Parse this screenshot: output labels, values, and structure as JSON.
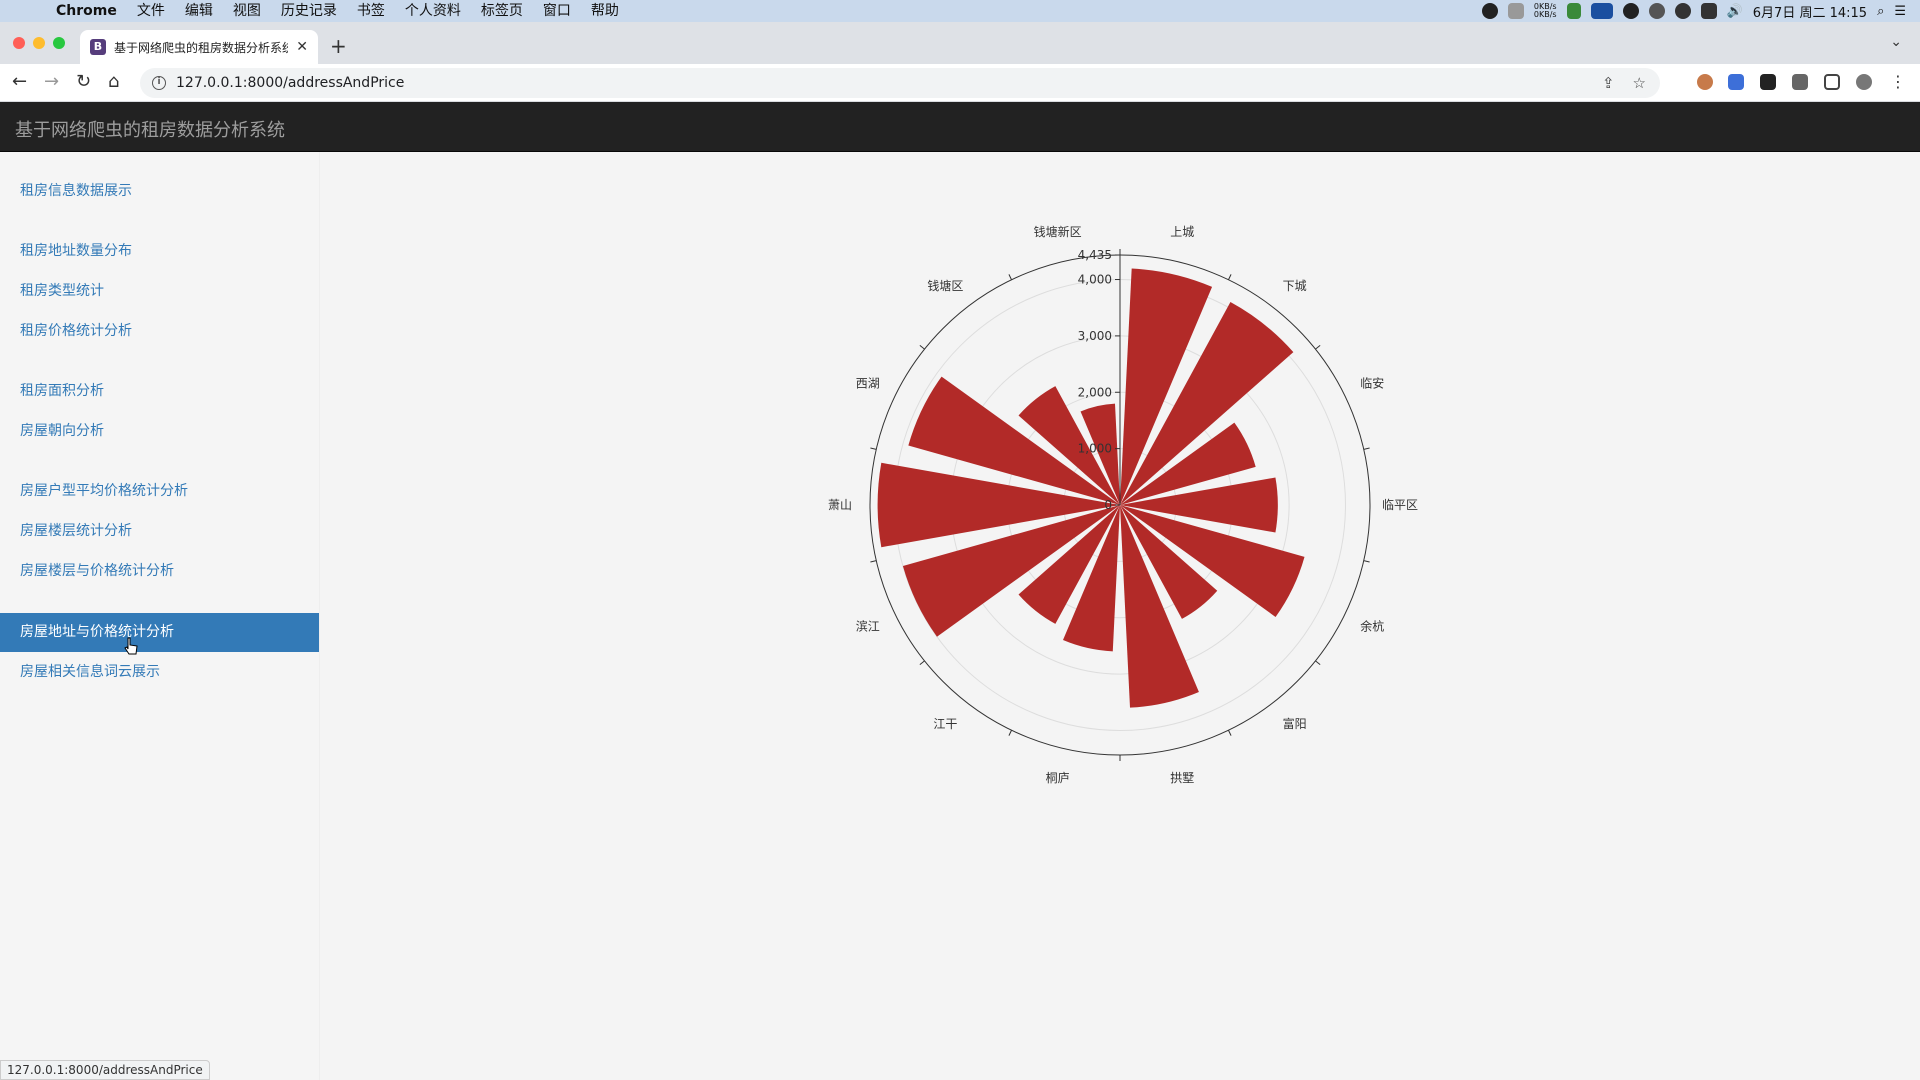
{
  "menubar": {
    "app": "Chrome",
    "items": [
      "文件",
      "编辑",
      "视图",
      "历史记录",
      "书签",
      "个人资料",
      "标签页",
      "窗口",
      "帮助"
    ],
    "net_up": "0KB/s",
    "net_down": "0KB/s",
    "datetime": "6月7日 周二 14:15"
  },
  "browser": {
    "tab_title": "基于网络爬虫的租房数据分析系统",
    "favicon_letter": "B",
    "url": "127.0.0.1:8000/addressAndPrice",
    "status_url": "127.0.0.1:8000/addressAndPrice"
  },
  "app": {
    "brand": "基于网络爬虫的租房数据分析系统"
  },
  "sidebar": {
    "items": [
      {
        "label": "租房信息数据展示"
      },
      {
        "label": "租房地址数量分布"
      },
      {
        "label": "租房类型统计"
      },
      {
        "label": "租房价格统计分析"
      },
      {
        "label": "租房面积分析"
      },
      {
        "label": "房屋朝向分析"
      },
      {
        "label": "房屋户型平均价格统计分析"
      },
      {
        "label": "房屋楼层统计分析"
      },
      {
        "label": "房屋楼层与价格统计分析"
      },
      {
        "label": "房屋地址与价格统计分析",
        "active": true
      },
      {
        "label": "房屋相关信息词云展示"
      }
    ]
  },
  "chart_data": {
    "type": "polar-bar",
    "title": "",
    "categories": [
      "上城",
      "下城",
      "临安",
      "临平区",
      "余杭",
      "富阳",
      "拱墅",
      "桐庐",
      "江干",
      "滨江",
      "萧山",
      "西湖",
      "钱塘区",
      "钱塘新区"
    ],
    "values": [
      4200,
      4100,
      2500,
      2800,
      3400,
      2300,
      3600,
      2600,
      2400,
      4000,
      4300,
      3900,
      2400,
      1800
    ],
    "radius_ticks": [
      0,
      1000,
      2000,
      3000,
      4000,
      4435
    ],
    "radius_tick_labels": [
      "0",
      "1,000",
      "2,000",
      "3,000",
      "4,000",
      "4,435"
    ],
    "radius_max": 4435,
    "bar_color": "#b22a28"
  }
}
